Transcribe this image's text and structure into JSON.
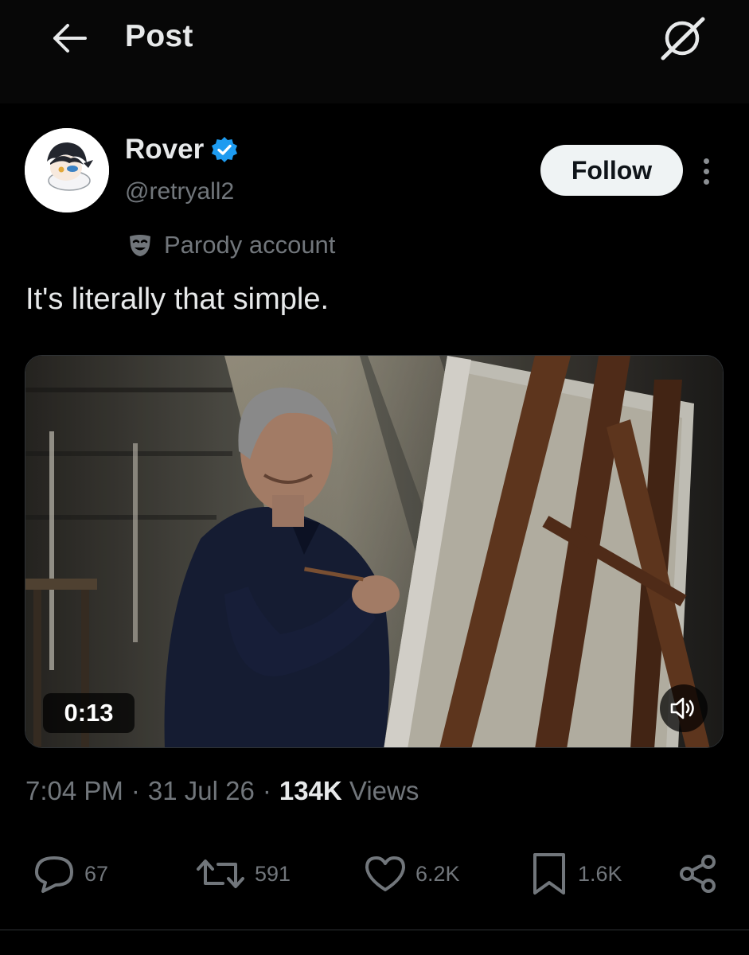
{
  "header": {
    "title": "Post",
    "back_icon": "arrow-left-icon",
    "grok_icon": "grok-icon"
  },
  "author": {
    "display_name": "Rover",
    "handle": "@retryall2",
    "verified": true,
    "verified_color": "#1d9bf0",
    "parody_label": "Parody account",
    "parody_icon": "mask-icon"
  },
  "follow_button": {
    "label": "Follow"
  },
  "post": {
    "text": "It's literally that simple."
  },
  "media": {
    "type": "video",
    "duration": "0:13",
    "muted_icon": "speaker-icon"
  },
  "meta": {
    "time": "7:04 PM",
    "separator": "·",
    "date": "31 Jul 26",
    "views_count": "134K",
    "views_label": "Views"
  },
  "actions": {
    "replies": "67",
    "reposts": "591",
    "likes": "6.2K",
    "bookmarks": "1.6K",
    "share_icon": "share-icon"
  },
  "colors": {
    "background": "#000000",
    "text_primary": "#e7e9ea",
    "text_secondary": "#71767b",
    "accent": "#1d9bf0"
  }
}
